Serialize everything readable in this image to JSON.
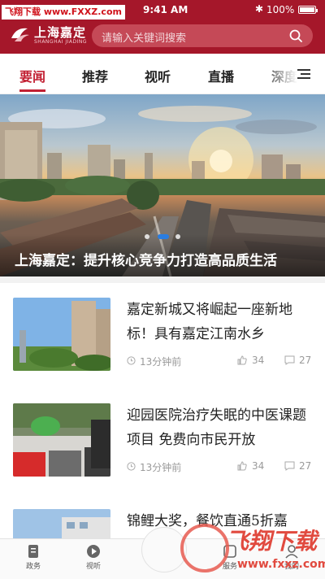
{
  "status_bar": {
    "watermark": "飞翔下载 www.FXXZ.com",
    "time": "9:41 AM",
    "battery": "100%"
  },
  "header": {
    "logo_cn": "上海嘉定",
    "logo_en": "SHANGHAI JIADING",
    "search_placeholder": "请输入关键词搜索",
    "brand_color": "#a5172a"
  },
  "tabs": [
    {
      "label": "要闻",
      "active": true
    },
    {
      "label": "推荐",
      "active": false
    },
    {
      "label": "视听",
      "active": false
    },
    {
      "label": "直播",
      "active": false
    },
    {
      "label": "深度",
      "active": false
    }
  ],
  "hero": {
    "caption": "上海嘉定：提升核心竞争力打造高品质生活",
    "carousel_count": 3,
    "carousel_active": 2
  },
  "news": [
    {
      "title": "嘉定新城又将崛起一座新地标！具有嘉定江南水乡",
      "time": "13分钟前",
      "likes": "34",
      "comments": "27"
    },
    {
      "title": "迎园医院治疗失眠的中医课题项目 免费向市民开放",
      "time": "13分钟前",
      "likes": "34",
      "comments": "27"
    },
    {
      "title": "锦鲤大奖，餐饮直通5折嘉",
      "time": "",
      "likes": "",
      "comments": ""
    }
  ],
  "bottom_nav": [
    {
      "label": "政务",
      "icon": "document-icon"
    },
    {
      "label": "视听",
      "icon": "play-icon"
    },
    {
      "label": "服务",
      "icon": "service-icon"
    },
    {
      "label": "我的",
      "icon": "user-icon"
    }
  ],
  "watermark_br": {
    "text1": "飞翔下载",
    "text2": "www.fxxz.com"
  }
}
